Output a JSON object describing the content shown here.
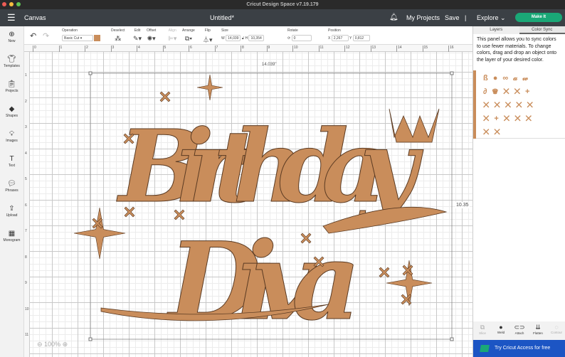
{
  "window": {
    "title": "Cricut Design Space  v7.19.179"
  },
  "header": {
    "menu_label": "Canvas",
    "doc_title": "Untitled*",
    "my_projects": "My Projects",
    "save": "Save",
    "separator": "|",
    "explore": "Explore",
    "make_it": "Make It"
  },
  "toolbar": {
    "operation_label": "Operation",
    "operation_value": "Basic Cut",
    "color": "#c98d5b",
    "deselect": "Deselect",
    "edit": "Edit",
    "offset": "Offset",
    "align": "Align",
    "arrange": "Arrange",
    "flip": "Flip",
    "size_label": "Size",
    "w_label": "W",
    "w_value": "14,039",
    "h_label": "H",
    "h_value": "10,354",
    "rotate_label": "Rotate",
    "rotate_value": "0",
    "position_label": "Position",
    "x_label": "X",
    "x_value": "2,267",
    "y_label": "Y",
    "y_value": "0,812"
  },
  "sidebar": {
    "items": [
      {
        "label": "New",
        "icon": "plus-circle-icon"
      },
      {
        "label": "Templates",
        "icon": "shirt-icon"
      },
      {
        "label": "Projects",
        "icon": "clipboard-icon"
      },
      {
        "label": "Shapes",
        "icon": "shapes-icon"
      },
      {
        "label": "Images",
        "icon": "bulb-icon"
      },
      {
        "label": "Text",
        "icon": "text-icon"
      },
      {
        "label": "Phrases",
        "icon": "speech-icon"
      },
      {
        "label": "Upload",
        "icon": "upload-icon"
      },
      {
        "label": "Monogram",
        "icon": "monogram-icon"
      }
    ]
  },
  "ruler": {
    "h": [
      "0",
      "1",
      "2",
      "3",
      "4",
      "5",
      "6",
      "7",
      "8",
      "9",
      "10",
      "11",
      "12",
      "13",
      "14",
      "15",
      "16"
    ],
    "v": [
      "1",
      "2",
      "3",
      "4",
      "5",
      "6",
      "7",
      "8",
      "9",
      "10",
      "11"
    ]
  },
  "canvas": {
    "width_label": "14.039\"",
    "height_label": "10.35",
    "zoom": "100%",
    "design_line1": "Birthday",
    "design_line2": "Diva"
  },
  "panel": {
    "tab_layers": "Layers",
    "tab_colorsync": "Color Sync",
    "description": "This panel allows you to sync colors to use fewer materials. To change colors, drag and drop an object onto the layer of your desired color.",
    "swatch": "#c98d5b"
  },
  "bottom_tools": [
    {
      "label": "Slice",
      "icon": "slice-icon"
    },
    {
      "label": "Weld",
      "icon": "weld-icon"
    },
    {
      "label": "Attach",
      "icon": "attach-icon"
    },
    {
      "label": "Flatten",
      "icon": "flatten-icon"
    },
    {
      "label": "Contour",
      "icon": "contour-icon"
    }
  ],
  "access": {
    "label": "Try Cricut Access for free"
  }
}
